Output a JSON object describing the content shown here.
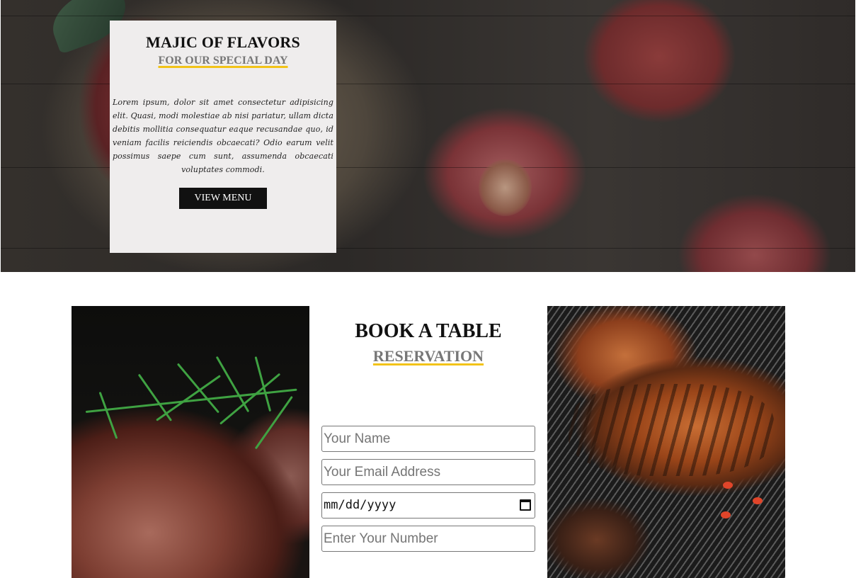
{
  "hero": {
    "title": "MAJIC OF FLAVORS",
    "subtitle": "FOR OUR SPECIAL DAY",
    "body": "Lorem ipsum, dolor sit amet consectetur adipisicing elit. Quasi, modi molestiae ab nisi pariatur, ullam dicta debitis mollitia consequatur eaque recusandae quo, id veniam facilis reiciendis obcaecati? Odio earum velit possimus saepe cum sunt, assumenda obcaecati voluptates commodi.",
    "button_label": "VIEW MENU"
  },
  "reservation": {
    "title": "BOOK A TABLE",
    "subtitle": "RESERVATION",
    "name_placeholder": "Your Name",
    "email_placeholder": "Your Email Address",
    "date_placeholder": "mm/dd/yyyy",
    "number_placeholder": "Enter Your Number"
  },
  "colors": {
    "accent": "#f2c318",
    "subtitle_gray": "#777777",
    "button_bg": "#111111"
  },
  "icons": {
    "date_picker": "calendar-icon"
  }
}
